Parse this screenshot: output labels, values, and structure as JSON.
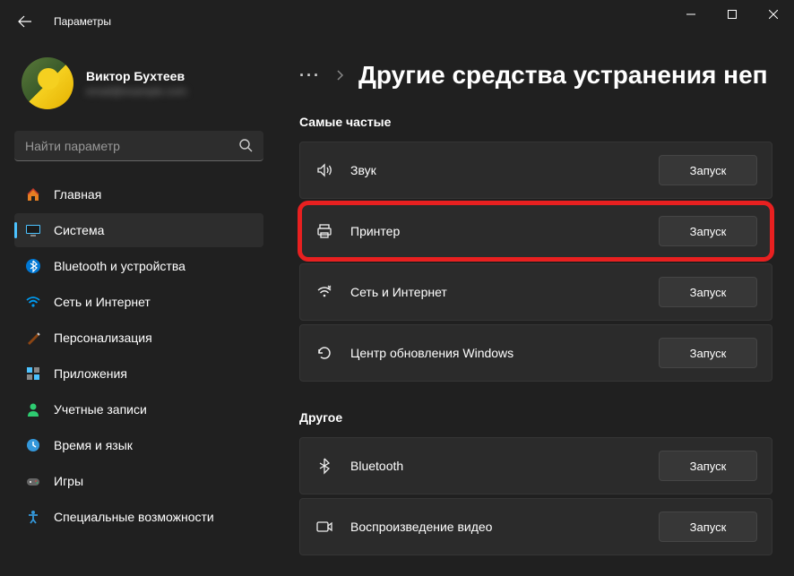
{
  "titlebar": {
    "title": "Параметры"
  },
  "profile": {
    "name": "Виктор Бухтеев",
    "email": "email@example.com"
  },
  "search": {
    "placeholder": "Найти параметр"
  },
  "nav": {
    "items": [
      {
        "label": "Главная",
        "icon": "home"
      },
      {
        "label": "Система",
        "icon": "system"
      },
      {
        "label": "Bluetooth и устройства",
        "icon": "bluetooth"
      },
      {
        "label": "Сеть и Интернет",
        "icon": "wifi"
      },
      {
        "label": "Персонализация",
        "icon": "brush"
      },
      {
        "label": "Приложения",
        "icon": "apps"
      },
      {
        "label": "Учетные записи",
        "icon": "account"
      },
      {
        "label": "Время и язык",
        "icon": "clock"
      },
      {
        "label": "Игры",
        "icon": "games"
      },
      {
        "label": "Специальные возможности",
        "icon": "accessibility"
      }
    ],
    "activeIndex": 1
  },
  "breadcrumb": {
    "title": "Другие средства устранения неп"
  },
  "sections": [
    {
      "label": "Самые частые",
      "items": [
        {
          "label": "Звук",
          "icon": "sound",
          "action": "Запуск",
          "highlighted": false
        },
        {
          "label": "Принтер",
          "icon": "printer",
          "action": "Запуск",
          "highlighted": true
        },
        {
          "label": "Сеть и Интернет",
          "icon": "network",
          "action": "Запуск",
          "highlighted": false
        },
        {
          "label": "Центр обновления Windows",
          "icon": "update",
          "action": "Запуск",
          "highlighted": false
        }
      ]
    },
    {
      "label": "Другое",
      "items": [
        {
          "label": "Bluetooth",
          "icon": "bluetooth2",
          "action": "Запуск",
          "highlighted": false
        },
        {
          "label": "Воспроизведение видео",
          "icon": "video",
          "action": "Запуск",
          "highlighted": false
        }
      ]
    }
  ],
  "actionLabel": "Запуск"
}
